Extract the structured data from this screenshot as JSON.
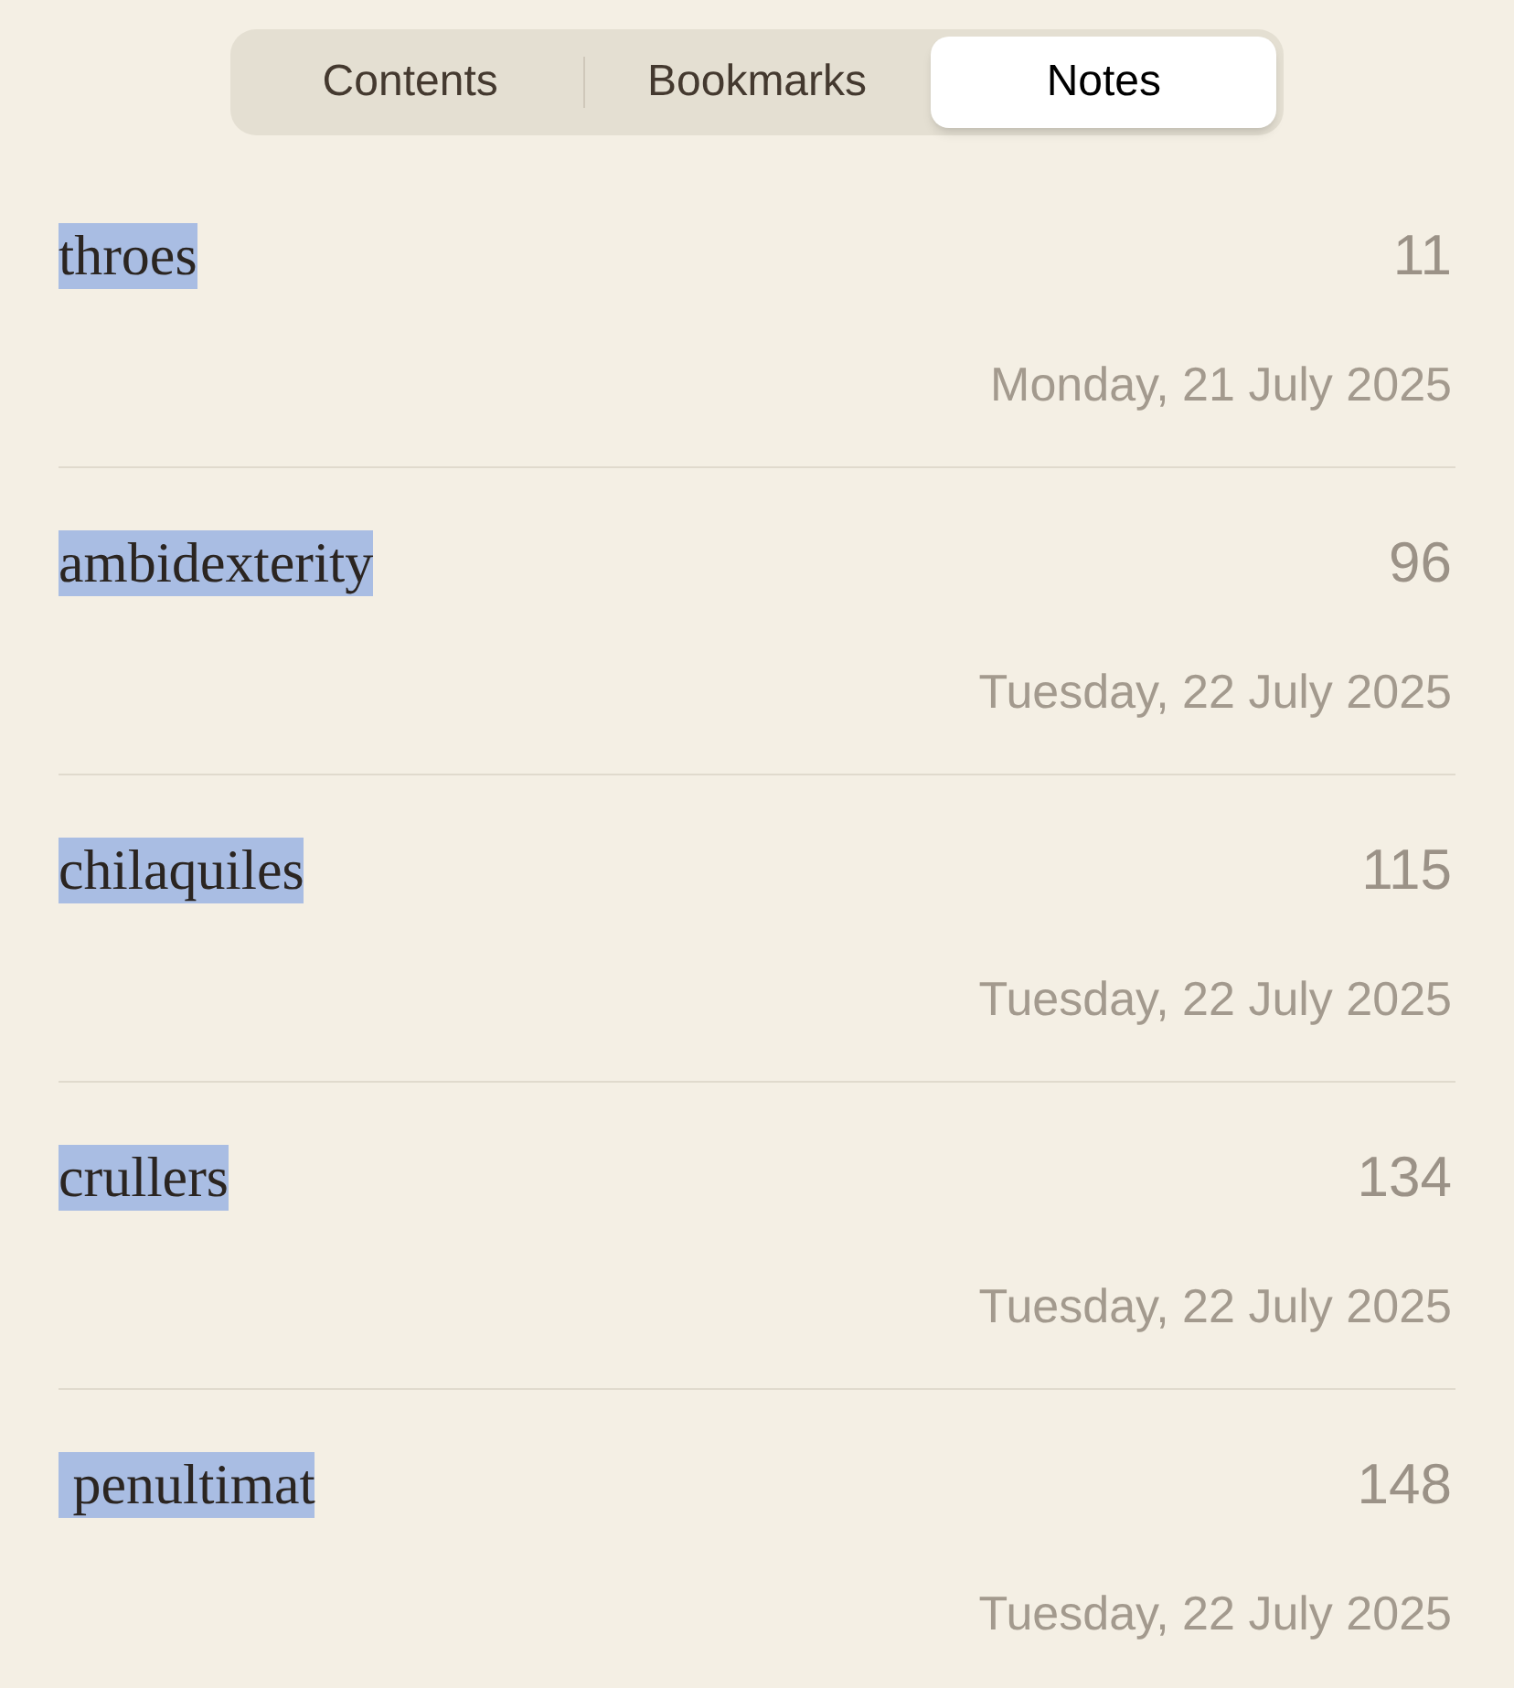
{
  "tabs": [
    {
      "label": "Contents",
      "selected": false
    },
    {
      "label": "Bookmarks",
      "selected": false
    },
    {
      "label": "Notes",
      "selected": true
    }
  ],
  "notes": [
    {
      "highlight": "throes",
      "page": "11",
      "date": "Monday, 21 July 2025"
    },
    {
      "highlight": "ambidexterity",
      "page": "96",
      "date": "Tuesday, 22 July 2025"
    },
    {
      "highlight": "chilaquiles",
      "page": "115",
      "date": "Tuesday, 22 July 2025"
    },
    {
      "highlight": "crullers",
      "page": "134",
      "date": "Tuesday, 22 July 2025"
    },
    {
      "highlight": " penultimat",
      "page": "148",
      "date": "Tuesday, 22 July 2025"
    }
  ]
}
